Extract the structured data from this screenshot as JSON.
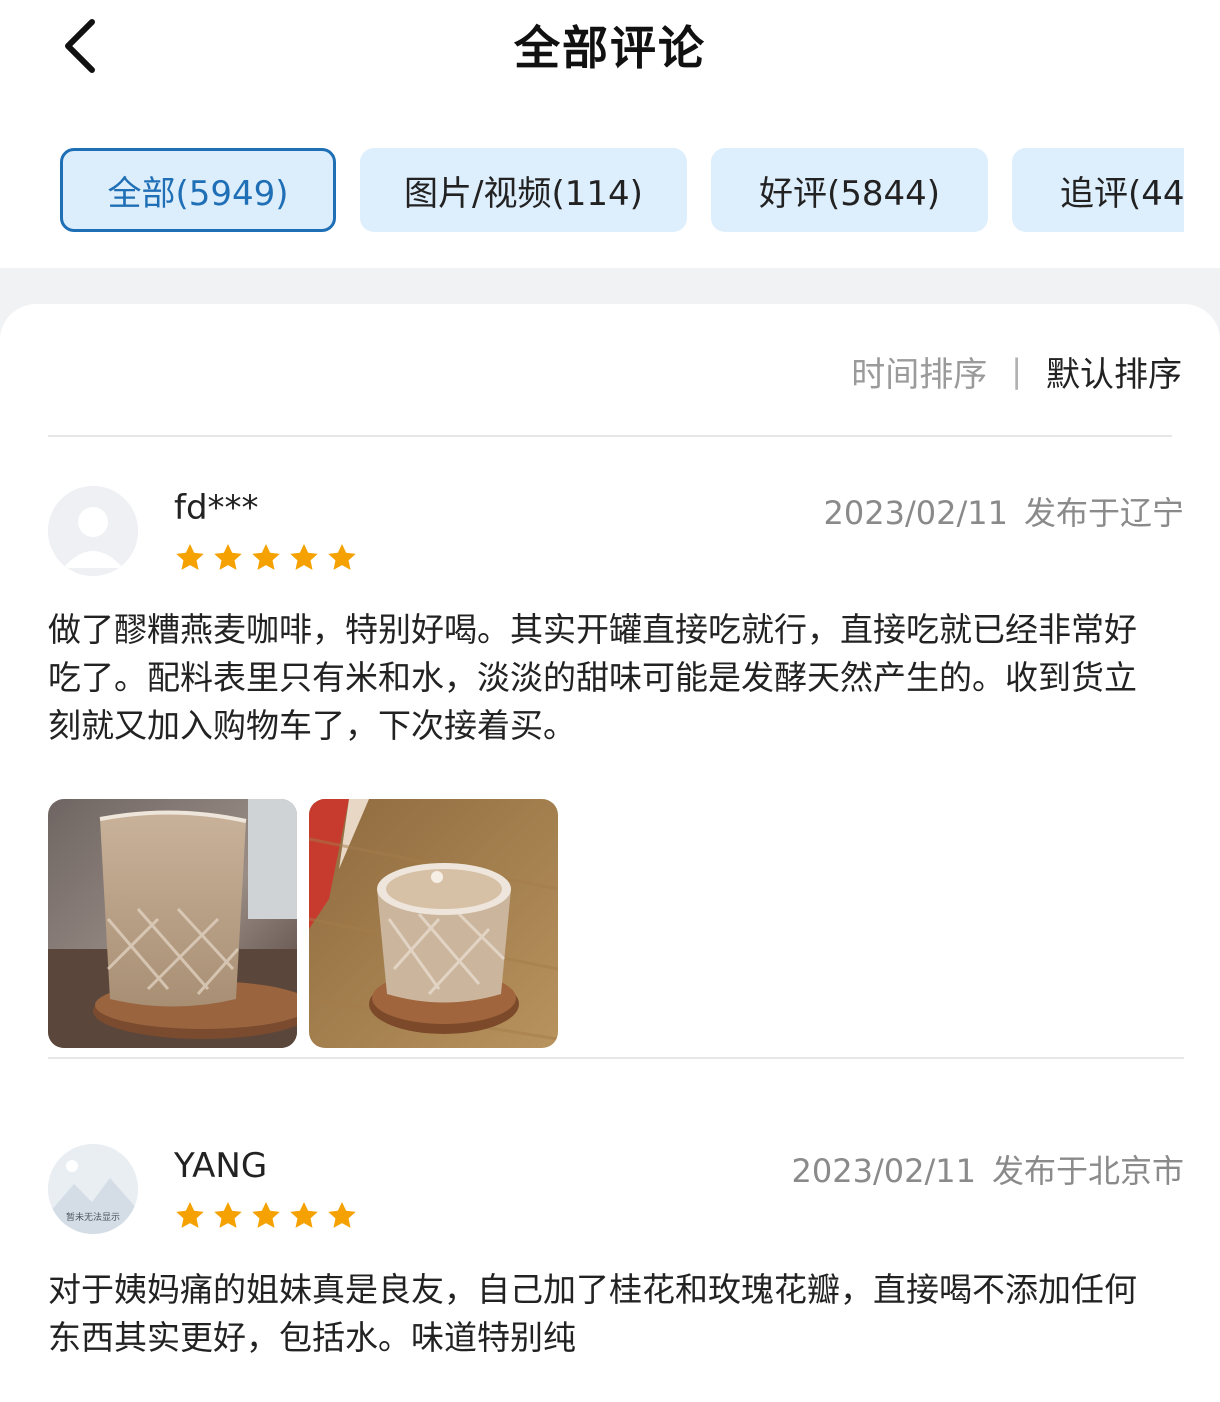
{
  "header": {
    "title": "全部评论",
    "back_icon": "chevron-left-icon"
  },
  "tabs": [
    {
      "label": "全部(5949)",
      "active": true
    },
    {
      "label": "图片/视频(114)",
      "active": false
    },
    {
      "label": "好评(5844)",
      "active": false
    },
    {
      "label": "追评(44",
      "active": false
    }
  ],
  "sort": {
    "time_label": "时间排序",
    "divider": "|",
    "default_label": "默认排序"
  },
  "colors": {
    "accent": "#1f6fb6",
    "tab_bg": "#ddeefc",
    "star": "#f5a100",
    "muted": "#8a8a8a"
  },
  "reviews": [
    {
      "username": "fd***",
      "rating": 5,
      "date": "2023/02/11",
      "location": "发布于辽宁",
      "text": "做了醪糟燕麦咖啡，特别好喝。其实开罐直接吃就行，直接吃就已经非常好吃了。配料表里只有米和水，淡淡的甜味可能是发酵天然产生的。收到货立刻就又加入购物车了，下次接着买。",
      "photos": [
        "iced-coffee-glass-photo",
        "coffee-glass-top-photo"
      ]
    },
    {
      "username": "YANG",
      "rating": 5,
      "date": "2023/02/11",
      "location": "发布于北京市",
      "avatar_caption": "暂未无法显示",
      "text": "对于姨妈痛的姐妹真是良友，自己加了桂花和玫瑰花瓣，直接喝不添加任何东西其实更好，包括水。味道特别纯"
    }
  ]
}
